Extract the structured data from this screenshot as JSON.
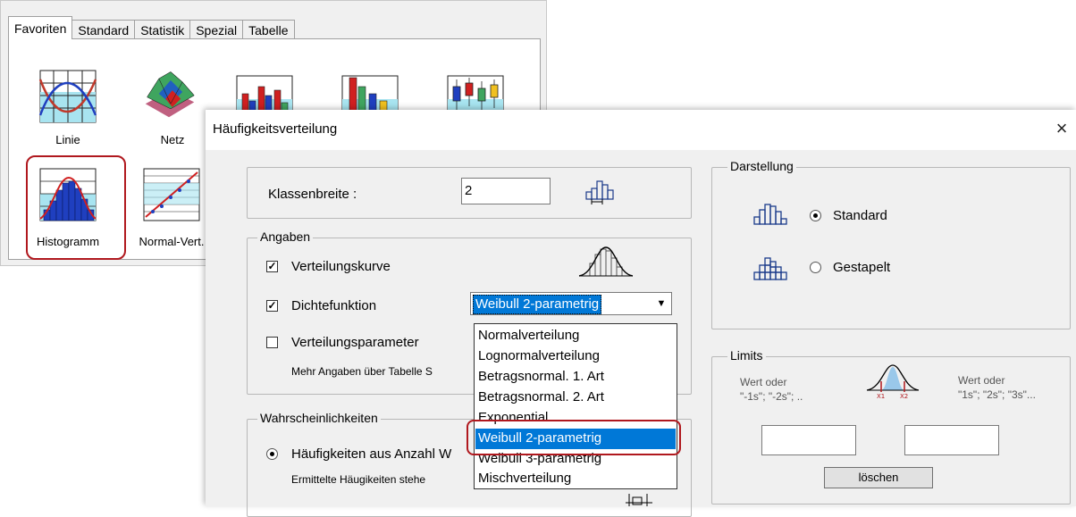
{
  "gallery": {
    "tabs": [
      "Favoriten",
      "Standard",
      "Statistik",
      "Spezial",
      "Tabelle"
    ],
    "active_tab": "Favoriten",
    "icons": {
      "linie": "Linie",
      "netz": "Netz",
      "histogramm": "Histogramm",
      "normal_vert": "Normal-Vert."
    }
  },
  "dialog": {
    "title": "Häufigkeitsverteilung",
    "close_icon": "×",
    "klassenbreite": {
      "label": "Klassenbreite :",
      "value": "2"
    },
    "angaben": {
      "legend": "Angaben",
      "verteilungskurve": {
        "label": "Verteilungskurve",
        "checked": true
      },
      "dichtefunktion": {
        "label": "Dichtefunktion",
        "checked": true
      },
      "verteilungsparameter": {
        "label": "Verteilungsparameter",
        "checked": false
      },
      "note": "Mehr Angaben über Tabelle S",
      "check_mark": "✓"
    },
    "combo": {
      "value": "Weibull 2-parametrig",
      "arrow": "▼",
      "options": [
        "Normalverteilung",
        "Lognormalverteilung",
        "Betragsnormal. 1. Art",
        "Betragsnormal. 2. Art",
        "Exponential",
        "Weibull 2-parametrig",
        "Weibull 3-parametrig",
        "Mischverteilung"
      ],
      "selected_index": 5
    },
    "wahrscheinlichkeiten": {
      "legend": "Wahrscheinlichkeiten",
      "option1": "Häufigkeiten aus Anzahl W",
      "note": "Ermittelte Häugikeiten stehe"
    },
    "darstellung": {
      "legend": "Darstellung",
      "standard": "Standard",
      "gestapelt": "Gestapelt",
      "selected": "Standard"
    },
    "limits": {
      "legend": "Limits",
      "left_hint_1": "Wert oder",
      "left_hint_2": "\"-1s\";  \"-2s\"; ..",
      "right_hint_1": "Wert oder",
      "right_hint_2": "\"1s\";  \"2s\"; \"3s\"...",
      "x1": "X1",
      "x2": "X2",
      "lower_value": "",
      "upper_value": "",
      "clear_button": "löschen"
    }
  },
  "colors": {
    "highlight": "#b0181e",
    "selection": "#0078d7",
    "dialog_bg": "#f0f0f0"
  }
}
